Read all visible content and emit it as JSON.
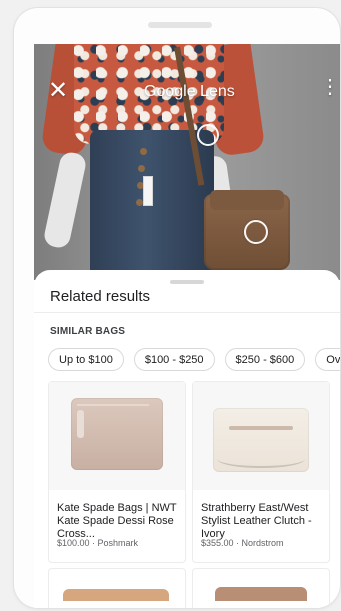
{
  "header": {
    "title": "Google Lens"
  },
  "overlay": {
    "icons": {
      "close": "close-icon",
      "menu": "more-vert-icon",
      "filter": "filter-icon",
      "crop": "crop-icon"
    }
  },
  "results": {
    "sheet_title": "Related results",
    "section_title": "SIMILAR BAGS",
    "chips": [
      "Up to $100",
      "$100 - $250",
      "$250 - $600",
      "Over"
    ],
    "cards": [
      {
        "title": "Kate Spade Bags | NWT Kate Spade Dessi Rose Cross...",
        "price": "$100.00 · Poshmark"
      },
      {
        "title": "Strathberry East/West Stylist Leather Clutch - Ivory",
        "price": "$355.00 · Nordstrom"
      }
    ]
  },
  "colors": {
    "background": "#f1f1f1",
    "sheet": "#ffffff",
    "text": "#202124",
    "muted": "#5f6368"
  }
}
